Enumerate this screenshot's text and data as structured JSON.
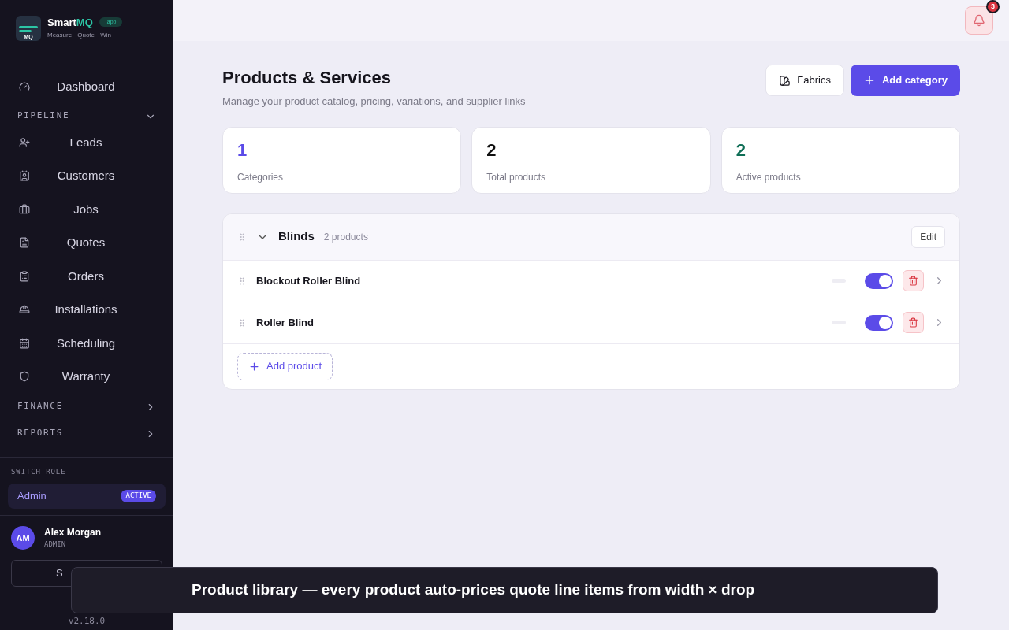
{
  "brand": {
    "name_a": "Smart",
    "name_b": "MQ",
    "logo_text": "MQ",
    "badge": ".app",
    "tagline": "Measure · Quote · Win"
  },
  "nav": [
    {
      "kind": "item",
      "label": "Dashboard",
      "selected": false
    },
    {
      "kind": "section",
      "label": "PIPELINE",
      "expanded": true
    },
    {
      "kind": "item",
      "label": "Leads",
      "selected": false
    },
    {
      "kind": "item",
      "label": "Customers",
      "selected": false
    },
    {
      "kind": "item",
      "label": "Jobs",
      "selected": false
    },
    {
      "kind": "item",
      "label": "Quotes",
      "selected": false
    },
    {
      "kind": "item",
      "label": "Orders",
      "selected": false
    },
    {
      "kind": "item",
      "label": "Installations",
      "selected": false
    },
    {
      "kind": "item",
      "label": "Scheduling",
      "selected": false
    },
    {
      "kind": "item",
      "label": "Warranty",
      "selected": false
    },
    {
      "kind": "section",
      "label": "FINANCE",
      "expanded": false
    },
    {
      "kind": "section",
      "label": "REPORTS",
      "expanded": false
    }
  ],
  "role": {
    "heading": "SWITCH ROLE",
    "name": "Admin",
    "badge": "ACTIVE"
  },
  "user": {
    "initials": "AM",
    "name": "Alex Morgan",
    "role": "ADMIN",
    "button": "S",
    "version": "v2.18.0"
  },
  "notifications": {
    "count": "3"
  },
  "page": {
    "title": "Products & Services",
    "subtitle": "Manage your product catalog, pricing, variations, and supplier links",
    "buttons": [
      {
        "kind": "secondary",
        "label": "Fabrics"
      },
      {
        "kind": "primary",
        "label": "Add category"
      }
    ]
  },
  "stats": [
    {
      "value": "1",
      "label": "Categories",
      "color": "#5b4be8"
    },
    {
      "value": "2",
      "label": "Total products",
      "color": "#111111"
    },
    {
      "value": "2",
      "label": "Active products",
      "color": "#0f6e56"
    }
  ],
  "category": {
    "name": "Blinds",
    "count": "2 products",
    "expanded": true,
    "edit": "Edit",
    "products": [
      {
        "name": "Blockout Roller Blind",
        "on": true
      },
      {
        "name": "Roller Blind",
        "on": true
      }
    ],
    "add": "Add product"
  },
  "toast": "Product library — every product auto-prices quote line items from width × drop"
}
